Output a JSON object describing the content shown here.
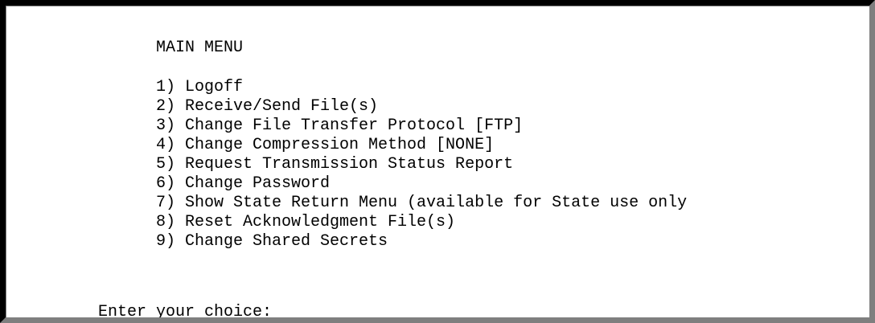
{
  "menu": {
    "title": "MAIN MENU",
    "items": [
      "1) Logoff",
      "2) Receive/Send File(s)",
      "3) Change File Transfer Protocol [FTP]",
      "4) Change Compression Method [NONE]",
      "5) Request Transmission Status Report",
      "6) Change Password",
      "7) Show State Return Menu (available for State use only",
      "8) Reset Acknowledgment File(s)",
      "9) Change Shared Secrets"
    ],
    "prompt": "Enter your choice:"
  }
}
